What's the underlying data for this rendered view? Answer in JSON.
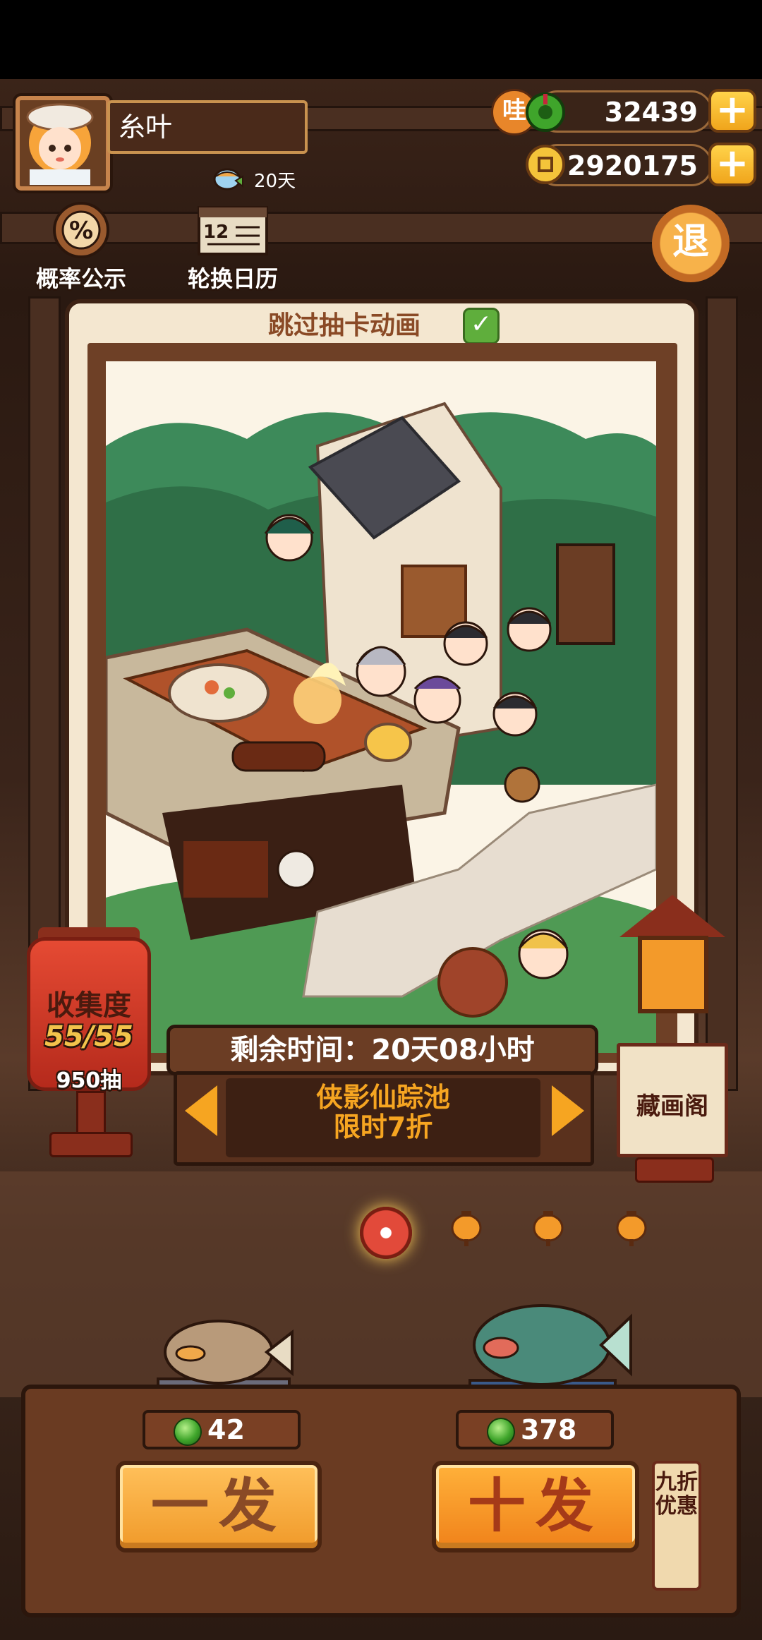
{
  "player": {
    "name": "糸叶",
    "days": "20天"
  },
  "currencies": {
    "gems": "32439",
    "coins": "2920175",
    "gem_badge": "哇"
  },
  "top_buttons": {
    "probability": "概率公示",
    "calendar": "轮换日历",
    "exit": "退",
    "calendar_number": "12"
  },
  "card": {
    "skip_animation": "跳过抽卡动画"
  },
  "collection": {
    "title": "收集度",
    "count": "55/55",
    "draws": "950抽"
  },
  "banner": {
    "remaining": "剩余时间：20天08小时",
    "pool_line1": "侠影仙踪池",
    "pool_line2": "限时7折"
  },
  "gallery": {
    "label": "藏画阁"
  },
  "pulls": {
    "single_cost": "42",
    "ten_cost": "378",
    "single_label": "一发",
    "ten_label": "十发",
    "discount": "九折优惠"
  },
  "colors": {
    "accent": "#f6a521",
    "frame": "#6b3d24",
    "gem_green": "#3fa52b",
    "plus_yellow": "#ffd34a"
  }
}
